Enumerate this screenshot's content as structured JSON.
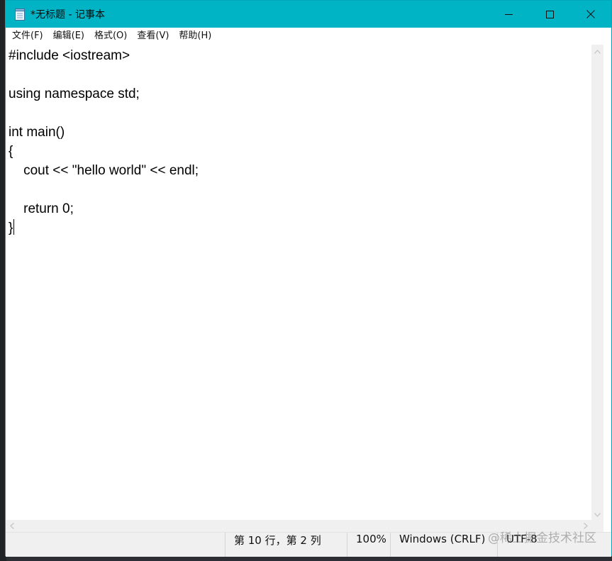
{
  "window": {
    "title": "*无标题 - 记事本"
  },
  "icons": {
    "app": "notepad-icon",
    "minimize": "minimize-icon",
    "maximize": "maximize-icon",
    "close": "close-icon"
  },
  "menu": {
    "items": [
      {
        "label": "文件(F)"
      },
      {
        "label": "编辑(E)"
      },
      {
        "label": "格式(O)"
      },
      {
        "label": "查看(V)"
      },
      {
        "label": "帮助(H)"
      }
    ]
  },
  "editor": {
    "lines": [
      "#include <iostream>",
      "",
      "using namespace std;",
      "",
      "int main()",
      "{",
      "    cout << \"hello world\" << endl;",
      "",
      "    return 0;",
      "}"
    ]
  },
  "status": {
    "position": "第 10 行，第 2 列",
    "zoom": "100%",
    "line_ending": "Windows (CRLF)",
    "encoding": "UTF-8"
  },
  "watermark": "@稀土掘金技术社区",
  "colors": {
    "titlebar": "#00b4c6",
    "status_bg": "#f0f0f0"
  }
}
